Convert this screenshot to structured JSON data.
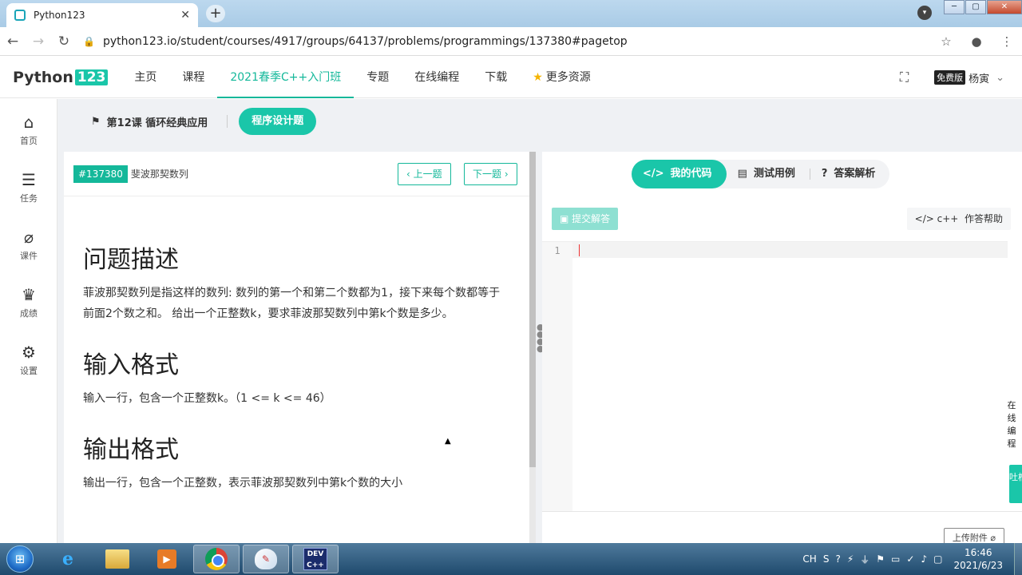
{
  "browser": {
    "tab_title": "Python123",
    "tab_close": "✕",
    "new_tab": "+",
    "window_min": "─",
    "window_max": "▢",
    "window_close": "✕",
    "url": "python123.io/student/courses/4917/groups/64137/problems/programmings/137380#pagetop"
  },
  "site": {
    "logo_text": "Python",
    "logo_num": "123",
    "menu": [
      {
        "label": "主页"
      },
      {
        "label": "课程"
      },
      {
        "label": "2021春季C++入门班"
      },
      {
        "label": "专题"
      },
      {
        "label": "在线编程"
      },
      {
        "label": "下载"
      },
      {
        "label": "更多资源"
      }
    ],
    "version_badge": "免费版",
    "username": "杨寅",
    "user_chevron": "⌄"
  },
  "sidebar": [
    {
      "label": "首页",
      "icon": "home-icon"
    },
    {
      "label": "任务",
      "icon": "tasks-icon"
    },
    {
      "label": "课件",
      "icon": "paperclip-icon"
    },
    {
      "label": "成绩",
      "icon": "trophy-icon"
    },
    {
      "label": "设置",
      "icon": "gear-icon"
    }
  ],
  "breadcrumb": {
    "lesson": "第12课 循环经典应用",
    "type": "程序设计题"
  },
  "problem": {
    "id": "#137380",
    "name": "斐波那契数列",
    "prev": "上一题",
    "next": "下一题",
    "sections": [
      {
        "title": "问题描述",
        "text": "菲波那契数列是指这样的数列: 数列的第一个和第二个数都为1，接下来每个数都等于前面2个数之和。 给出一个正整数k，要求菲波那契数列中第k个数是多少。"
      },
      {
        "title": "输入格式",
        "text": "输入一行，包含一个正整数k。（1 <= k <= 46）"
      },
      {
        "title": "输出格式",
        "text": "输出一行，包含一个正整数，表示菲波那契数列中第k个数的大小"
      }
    ]
  },
  "code_panel": {
    "tabs": [
      {
        "label": "我的代码",
        "glyph": "</>"
      },
      {
        "label": "测试用例",
        "glyph": "▤"
      },
      {
        "label": "答案解析",
        "glyph": "?"
      }
    ],
    "submit": "提交解答",
    "lang": "c++",
    "help": "作答帮助",
    "line_number": "1",
    "upload": "上传附件"
  },
  "float_side": {
    "label": "在线编程",
    "feedback": "吐槽"
  },
  "taskbar": {
    "dev_label": "DEV C++",
    "tray_lang": "CH",
    "time": "16:46",
    "date": "2021/6/23"
  },
  "colors": {
    "accent": "#1ac6a9",
    "accent_dark": "#14b89a"
  }
}
